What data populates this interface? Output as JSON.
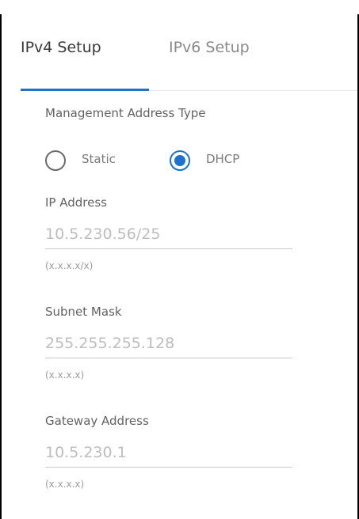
{
  "tabs": [
    {
      "label": "IPv4 Setup",
      "active": true
    },
    {
      "label": "IPv6 Setup",
      "active": false
    }
  ],
  "management": {
    "label": "Management Address Type",
    "options": [
      {
        "label": "Static",
        "checked": false
      },
      {
        "label": "DHCP",
        "checked": true
      }
    ]
  },
  "fields": [
    {
      "label": "IP Address",
      "value": "10.5.230.56/25",
      "hint": "(x.x.x.x/x)"
    },
    {
      "label": "Subnet Mask",
      "value": "255.255.255.128",
      "hint": "(x.x.x.x)"
    },
    {
      "label": "Gateway Address",
      "value": "10.5.230.1",
      "hint": "(x.x.x.x)"
    }
  ],
  "colors": {
    "accent": "#1e72c7",
    "label_text": "#626262",
    "disabled_value": "#bdbdbd"
  }
}
